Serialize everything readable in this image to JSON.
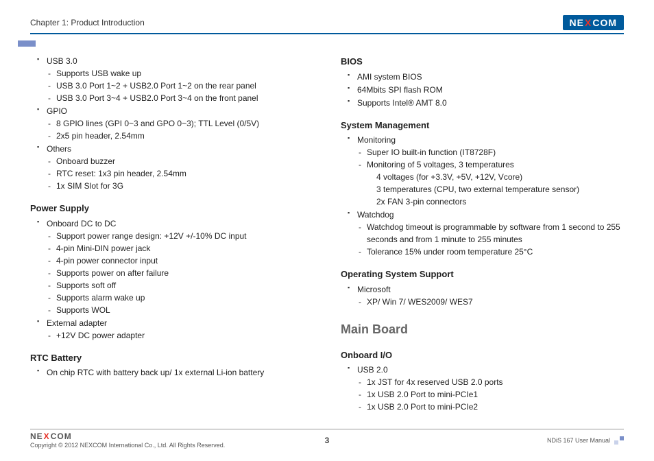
{
  "header": {
    "chapter": "Chapter 1: Product Introduction",
    "brand_a": "NE",
    "brand_x": "X",
    "brand_b": "COM"
  },
  "left": {
    "grp1": [
      {
        "label": "USB 3.0",
        "items": [
          "Supports USB wake up",
          "USB 3.0 Port 1~2 + USB2.0 Port 1~2 on the rear panel",
          "USB 3.0 Port 3~4 + USB2.0 Port 3~4 on the front panel"
        ]
      },
      {
        "label": "GPIO",
        "items": [
          "8 GPIO lines (GPI 0~3 and GPO 0~3); TTL Level (0/5V)",
          "2x5 pin header, 2.54mm"
        ]
      },
      {
        "label": "Others",
        "items": [
          "Onboard buzzer",
          "RTC reset: 1x3 pin header, 2.54mm",
          "1x SIM Slot for 3G"
        ]
      }
    ],
    "power_head": "Power Supply",
    "power": [
      {
        "label": "Onboard DC to DC",
        "items": [
          "Support power range design: +12V +/-10% DC input",
          "4-pin Mini-DIN power jack",
          "4-pin power connector input",
          "Supports power on after failure",
          "Supports soft off",
          "Supports alarm wake up",
          "Supports WOL"
        ]
      },
      {
        "label": "External adapter",
        "items": [
          "+12V DC power adapter"
        ]
      }
    ],
    "rtc_head": "RTC Battery",
    "rtc": [
      {
        "label": "On chip RTC with battery back up/ 1x external Li-ion battery",
        "items": []
      }
    ]
  },
  "right": {
    "bios_head": "BIOS",
    "bios": [
      {
        "label": "AMI system BIOS",
        "items": []
      },
      {
        "label": "64Mbits SPI flash ROM",
        "items": []
      },
      {
        "label": "Supports Intel® AMT 8.0",
        "items": []
      }
    ],
    "sys_head": "System Management",
    "sys": [
      {
        "label": "Monitoring",
        "items": [
          "Super IO built-in function (IT8728F)",
          "Monitoring of 5 voltages, 3 temperatures\n4 voltages (for +3.3V, +5V, +12V, Vcore)\n3 temperatures (CPU, two external temperature sensor)\n2x FAN 3-pin connectors"
        ]
      },
      {
        "label": "Watchdog",
        "items": [
          "Watchdog timeout is programmable by software from 1 second to 255 seconds and from 1 minute to 255 minutes",
          "Tolerance 15% under room temperature 25°C"
        ]
      }
    ],
    "os_head": "Operating System Support",
    "os": [
      {
        "label": "Microsoft",
        "items": [
          "XP/ Win 7/ WES2009/ WES7"
        ]
      }
    ],
    "mb_head": "Main Board",
    "io_head": "Onboard I/O",
    "io": [
      {
        "label": "USB 2.0",
        "items": [
          "1x JST for 4x reserved USB 2.0 ports",
          "1x USB 2.0 Port to mini-PCIe1",
          "1x USB 2.0 Port to mini-PCIe2"
        ]
      }
    ]
  },
  "footer": {
    "brand_a": "NE",
    "brand_x": "X",
    "brand_b": "COM",
    "copyright": "Copyright © 2012 NEXCOM International Co., Ltd. All Rights Reserved.",
    "page": "3",
    "manual": "NDiS 167 User Manual"
  }
}
